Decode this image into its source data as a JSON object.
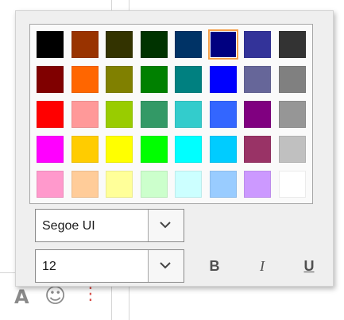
{
  "palette": {
    "rows": [
      [
        {
          "color": "#000000"
        },
        {
          "color": "#993300"
        },
        {
          "color": "#333300"
        },
        {
          "color": "#003300"
        },
        {
          "color": "#003366"
        },
        {
          "color": "#000080",
          "selected": true
        },
        {
          "color": "#333399"
        },
        {
          "color": "#333333"
        }
      ],
      [
        {
          "color": "#800000"
        },
        {
          "color": "#FF6600"
        },
        {
          "color": "#808000"
        },
        {
          "color": "#008000"
        },
        {
          "color": "#008080"
        },
        {
          "color": "#0000FF"
        },
        {
          "color": "#666699"
        },
        {
          "color": "#808080"
        }
      ],
      [
        {
          "color": "#FF0000"
        },
        {
          "color": "#FF9999"
        },
        {
          "color": "#99CC00"
        },
        {
          "color": "#339966"
        },
        {
          "color": "#33CCCC"
        },
        {
          "color": "#3366FF"
        },
        {
          "color": "#800080"
        },
        {
          "color": "#969696"
        }
      ],
      [
        {
          "color": "#FF00FF"
        },
        {
          "color": "#FFCC00"
        },
        {
          "color": "#FFFF00"
        },
        {
          "color": "#00FF00"
        },
        {
          "color": "#00FFFF"
        },
        {
          "color": "#00CCFF"
        },
        {
          "color": "#993366"
        },
        {
          "color": "#C0C0C0"
        }
      ],
      [
        {
          "color": "#FF99CC"
        },
        {
          "color": "#FFCC99"
        },
        {
          "color": "#FFFF99"
        },
        {
          "color": "#CCFFCC"
        },
        {
          "color": "#CCFFFF"
        },
        {
          "color": "#99CCFF"
        },
        {
          "color": "#CC99FF"
        },
        {
          "color": "#FFFFFF"
        }
      ]
    ]
  },
  "font_family": {
    "value": "Segoe UI",
    "dropdown_icon": "chevron-down-icon"
  },
  "font_size": {
    "value": "12",
    "dropdown_icon": "chevron-down-icon"
  },
  "format_buttons": {
    "bold": "B",
    "italic": "I",
    "underline": "U"
  },
  "background_icons": {
    "font_glyph": "A",
    "emoji_glyph": "☺",
    "more_glyph": "⋮"
  }
}
